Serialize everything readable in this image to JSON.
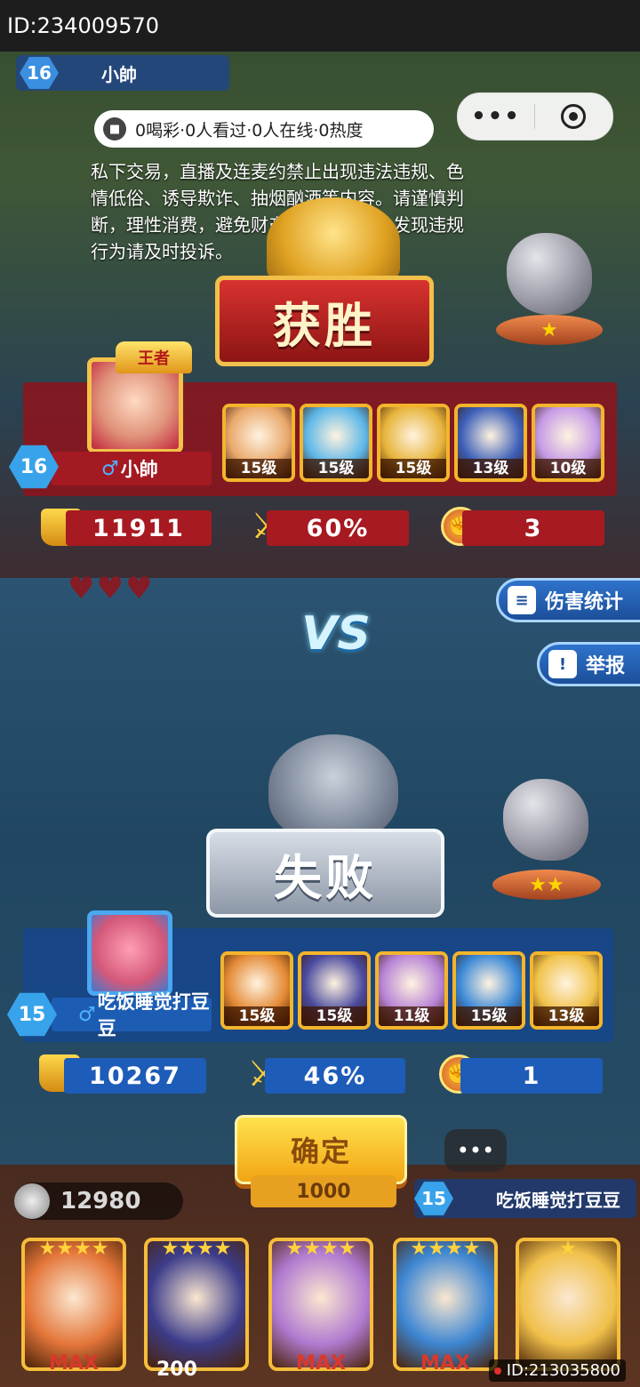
{
  "top_id": "ID:234009570",
  "bottom_id": "ID:213035800",
  "top_hud": {
    "level": "16",
    "name": "小帥"
  },
  "live_bar": {
    "text": "0喝彩·0人看过·0人在线·0热度"
  },
  "capsule": {
    "menu_icon": "more-dots-icon",
    "close_icon": "target-circle-icon"
  },
  "notice": {
    "lines": [
      "私下交易，直播及连麦约禁止出现违法违规、色",
      "情低俗、诱导欺诈、抽烟酗酒等内容。请谨慎判",
      "断，理性消费，避免财产及人身损失，发现违规",
      "行为请及时投诉。"
    ]
  },
  "winner": {
    "result": "获胜",
    "crown_label": "王者",
    "level": "16",
    "name": "小帥",
    "heroes": [
      {
        "level": "15级",
        "color": "#e9a86b"
      },
      {
        "level": "15级",
        "color": "#5db7e8"
      },
      {
        "level": "15级",
        "color": "#e7b43a"
      },
      {
        "level": "13级",
        "color": "#3c5fb8"
      },
      {
        "level": "10级",
        "color": "#c59be6"
      }
    ],
    "trophies": "11911",
    "win_rate": "60%",
    "wins": "3",
    "rock_stars": "★"
  },
  "vs_label": "VS",
  "side_buttons": {
    "damage_stats": "伤害统计",
    "report": "举报"
  },
  "loser": {
    "result": "失败",
    "level": "15",
    "name": "吃饭睡觉打豆豆",
    "heroes": [
      {
        "level": "15级",
        "color": "#e48a35"
      },
      {
        "level": "15级",
        "color": "#4a4a9e"
      },
      {
        "level": "11级",
        "color": "#b884d6"
      },
      {
        "level": "15级",
        "color": "#3a88d6"
      },
      {
        "level": "13级",
        "color": "#f0c24a"
      }
    ],
    "trophies": "10267",
    "win_rate": "46%",
    "wins": "1",
    "rock_stars": "★★"
  },
  "confirm_label": "确定",
  "chat_label": "•••",
  "bottom_bar": {
    "coins": "12980",
    "center_value": "1000",
    "opponent_level": "15",
    "opponent_name": "吃饭睡觉打豆豆"
  },
  "deck": [
    {
      "stars": "★★★★",
      "label": "MAX",
      "color": "#e4763a"
    },
    {
      "stars": "★★★★",
      "label": "",
      "color": "#3c3c8a"
    },
    {
      "stars": "★★★★",
      "label": "MAX",
      "color": "#b07ad0"
    },
    {
      "stars": "★★★★",
      "label": "MAX",
      "color": "#3d86d2"
    },
    {
      "stars": "★",
      "label": "",
      "color": "#f0c04a"
    }
  ],
  "deck_cost": "200"
}
